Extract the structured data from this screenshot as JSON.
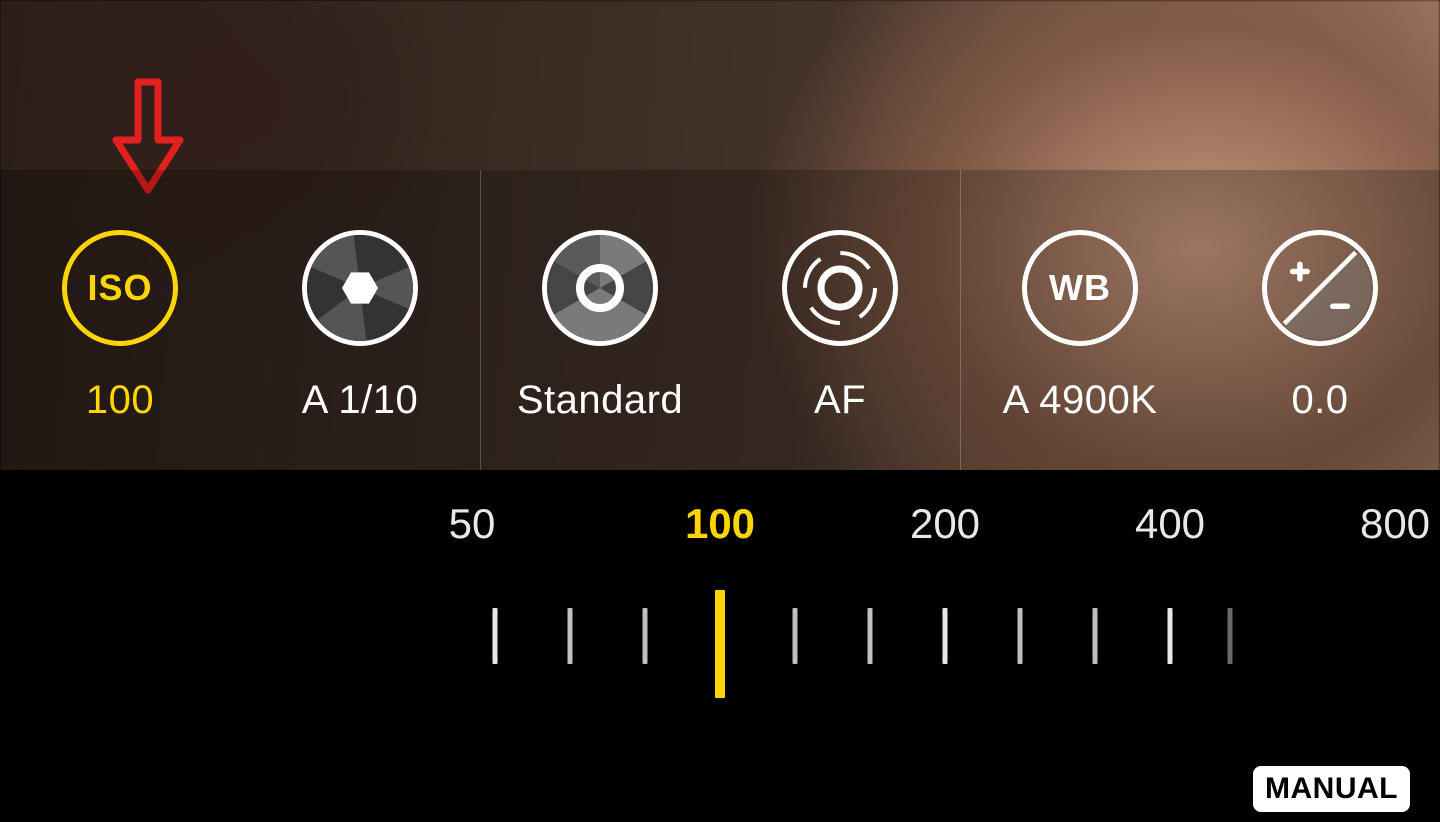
{
  "annotation": {
    "arrow_color": "#e32121"
  },
  "controls": [
    {
      "id": "iso",
      "label_inside": "ISO",
      "value": "100",
      "selected": true
    },
    {
      "id": "shutter",
      "value": "A 1/10"
    },
    {
      "id": "metering",
      "value": "Standard"
    },
    {
      "id": "focus",
      "value": "AF"
    },
    {
      "id": "wb",
      "label_inside": "WB",
      "value": "A 4900K"
    },
    {
      "id": "ev",
      "value": "0.0"
    }
  ],
  "iso_scale": {
    "labels": [
      "50",
      "100",
      "200",
      "400",
      "800"
    ],
    "current": "100"
  },
  "manual_label": "MANUAL",
  "colors": {
    "accent": "#ffd500"
  }
}
